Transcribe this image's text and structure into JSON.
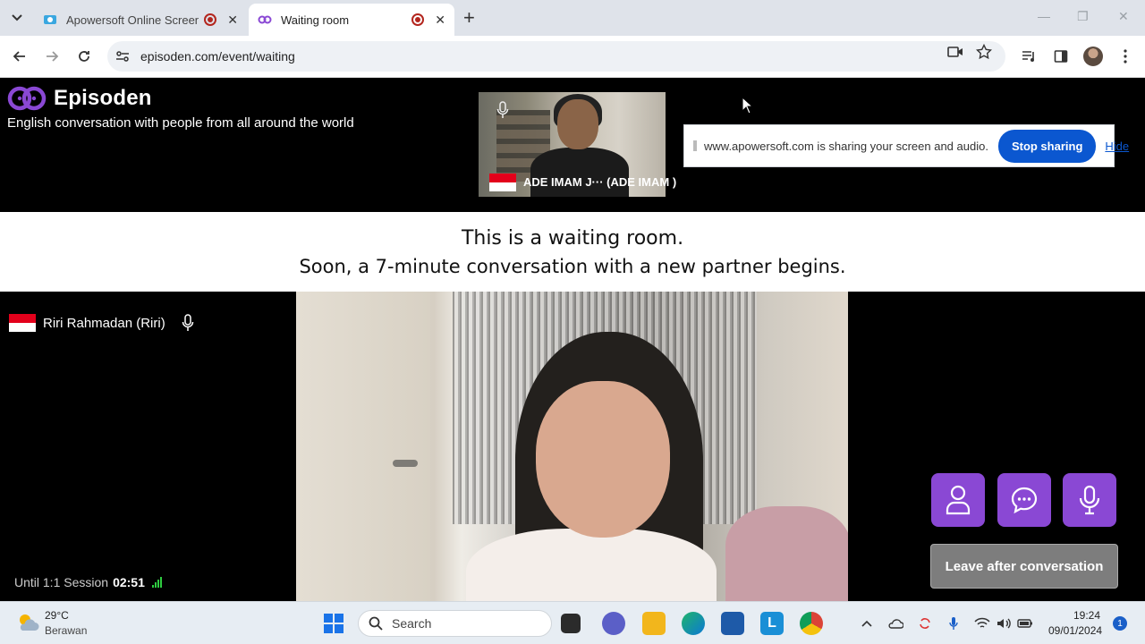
{
  "browser": {
    "tabs": [
      {
        "title": "Apowersoft Online Screen R",
        "favicon": "apowersoft-icon",
        "recording": true
      },
      {
        "title": "Waiting room",
        "favicon": "episoden-icon",
        "recording": true,
        "active": true
      }
    ],
    "url": "episoden.com/event/waiting"
  },
  "header": {
    "brand_name": "Episoden",
    "tagline": "English conversation with people from all around the world"
  },
  "self_video": {
    "name": "ADE IMAM J···   (ADE IMAM )",
    "flag": "indonesia-flag"
  },
  "share_bar": {
    "message": "www.apowersoft.com is sharing your screen and audio.",
    "stop_label": "Stop sharing",
    "hide_label": "Hide"
  },
  "banner": {
    "line1": "This is a waiting room.",
    "line2": "Soon, a 7-minute conversation with a new partner begins."
  },
  "partner": {
    "name": "Riri Rahmadan  (Riri)",
    "flag": "indonesia-flag"
  },
  "session": {
    "label": "Until 1:1 Session",
    "time": "02:51"
  },
  "actions": {
    "profile_icon": "person-icon",
    "chat_icon": "chat-icon",
    "mic_icon": "microphone-icon",
    "leave_label": "Leave after conversation"
  },
  "colors": {
    "accent": "#8a48d4",
    "share_button": "#0b57d0",
    "leave_button": "#7d7d7d",
    "flag_red": "#e3001b"
  },
  "taskbar": {
    "weather_temp": "29°C",
    "weather_desc": "Berawan",
    "search_placeholder": "Search",
    "time": "19:24",
    "date": "09/01/2024",
    "notifications": "1"
  }
}
